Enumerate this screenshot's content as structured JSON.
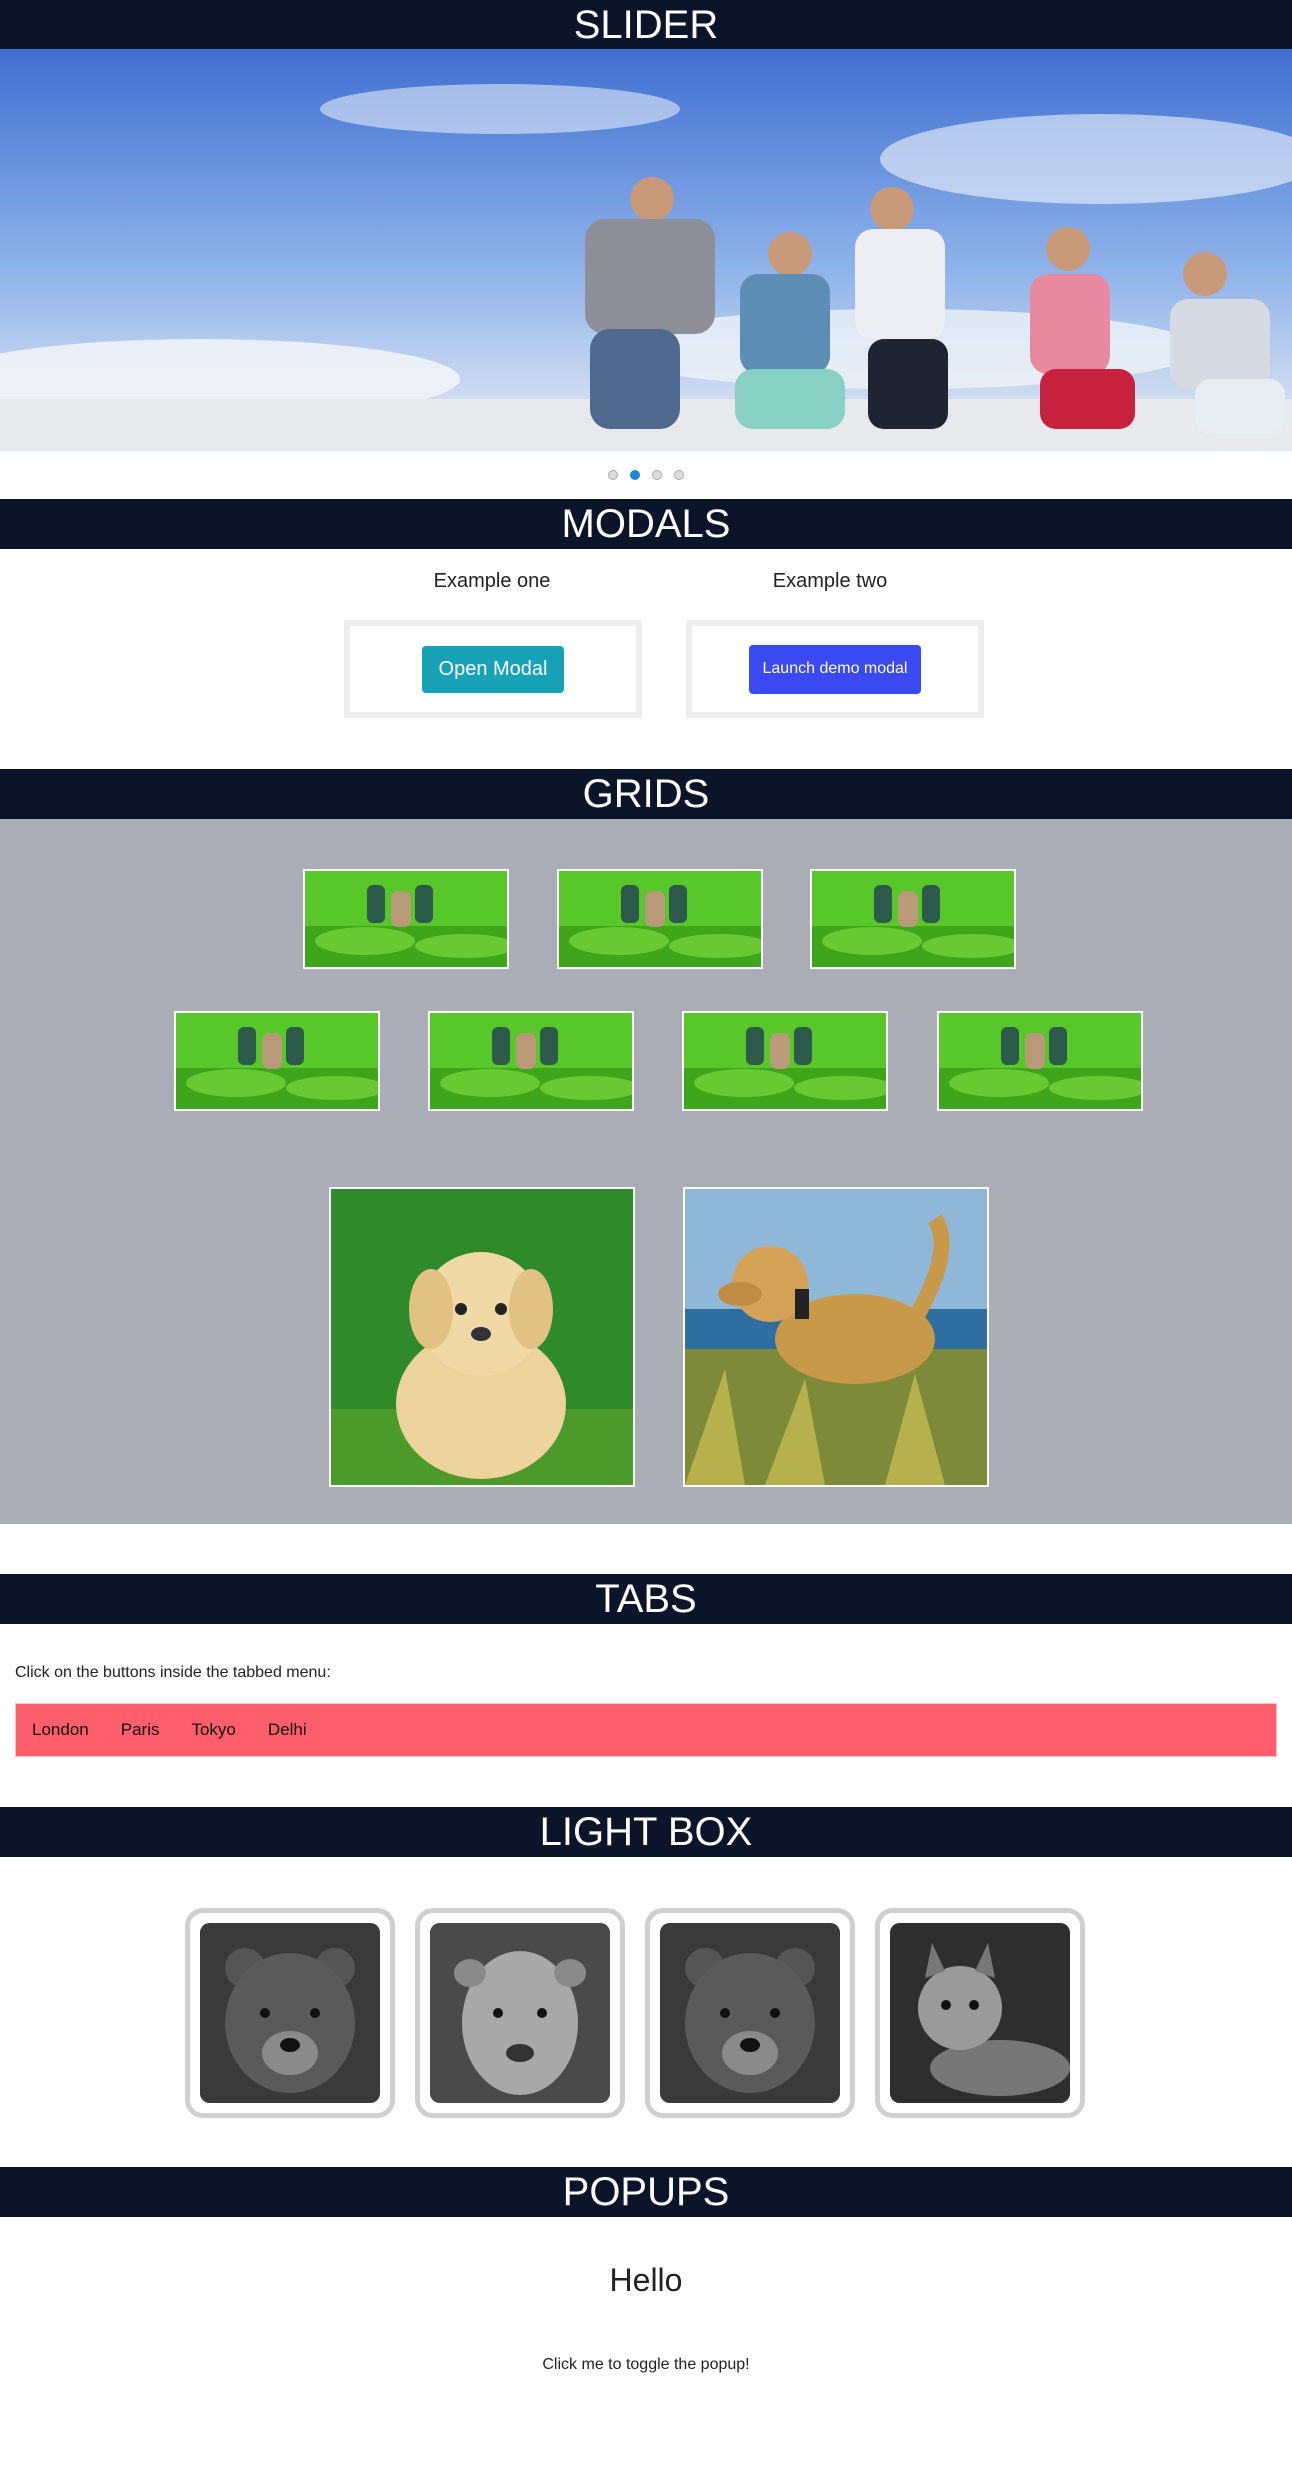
{
  "sections": {
    "slider": "SLIDER",
    "modals": "MODALS",
    "grids": "GRIDS",
    "tabs": "TABS",
    "lightbox": "LIGHT BOX",
    "popups": "POPUPS"
  },
  "slider": {
    "dot_count": 4,
    "active_dot": 2
  },
  "modals": {
    "example_one_label": "Example one",
    "example_two_label": "Example two",
    "open_modal_label": "Open Modal",
    "launch_modal_label": "Launch demo modal"
  },
  "tabs": {
    "description": "Click on the buttons inside the tabbed menu:",
    "items": [
      "London",
      "Paris",
      "Tokyo",
      "Delhi"
    ]
  },
  "popups": {
    "heading": "Hello",
    "toggle_text": "Click me to toggle the popup!"
  },
  "colors": {
    "header_bar": "#0b1429",
    "grid_background": "#abadb6",
    "tab_bar": "#ff5f6d",
    "open_modal_button": "#17a2b8",
    "launch_modal_button": "#3a4af0",
    "active_dot": "#1e88d6"
  }
}
